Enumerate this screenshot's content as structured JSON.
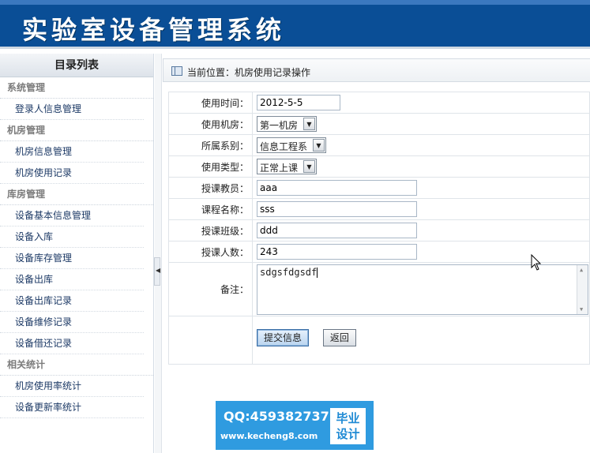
{
  "header": {
    "title": "实验室设备管理系统"
  },
  "sidebar": {
    "title": "目录列表",
    "groups": [
      {
        "label": "系统管理",
        "items": [
          "登录人信息管理"
        ]
      },
      {
        "label": "机房管理",
        "items": [
          "机房信息管理",
          "机房使用记录"
        ]
      },
      {
        "label": "库房管理",
        "items": [
          "设备基本信息管理",
          "设备入库",
          "设备库存管理",
          "设备出库",
          "设备出库记录",
          "设备维修记录",
          "设备借还记录"
        ]
      },
      {
        "label": "相关统计",
        "items": [
          "机房使用率统计",
          "设备更新率统计"
        ]
      }
    ]
  },
  "breadcrumb": {
    "text": "当前位置：机房使用记录操作"
  },
  "form": {
    "use_time": {
      "label": "使用时间：",
      "value": "2012-5-5"
    },
    "room": {
      "label": "使用机房：",
      "value": "第一机房"
    },
    "department": {
      "label": "所属系别：",
      "value": "信息工程系"
    },
    "use_type": {
      "label": "使用类型：",
      "value": "正常上课"
    },
    "teacher": {
      "label": "授课教员：",
      "value": "aaa"
    },
    "course": {
      "label": "课程名称：",
      "value": "sss"
    },
    "class": {
      "label": "授课班级：",
      "value": "ddd"
    },
    "headcount": {
      "label": "授课人数：",
      "value": "243"
    },
    "remark": {
      "label": "备注：",
      "value": "sdgsfdgsdf"
    },
    "submit_label": "提交信息",
    "back_label": "返回"
  },
  "watermark": {
    "qq": "QQ:459382737",
    "url": "www.kecheng8.com",
    "badge_line1": "毕业",
    "badge_line2": "设计"
  },
  "icons": {
    "breadcrumb": "window-icon",
    "collapse": "chevron-left-icon",
    "cursor": "mouse-pointer-icon"
  },
  "colors": {
    "header_bg": "#0a4e96",
    "link": "#1d3a66",
    "group_label": "#7b7b7b",
    "watermark_bg": "#2f9be0"
  }
}
